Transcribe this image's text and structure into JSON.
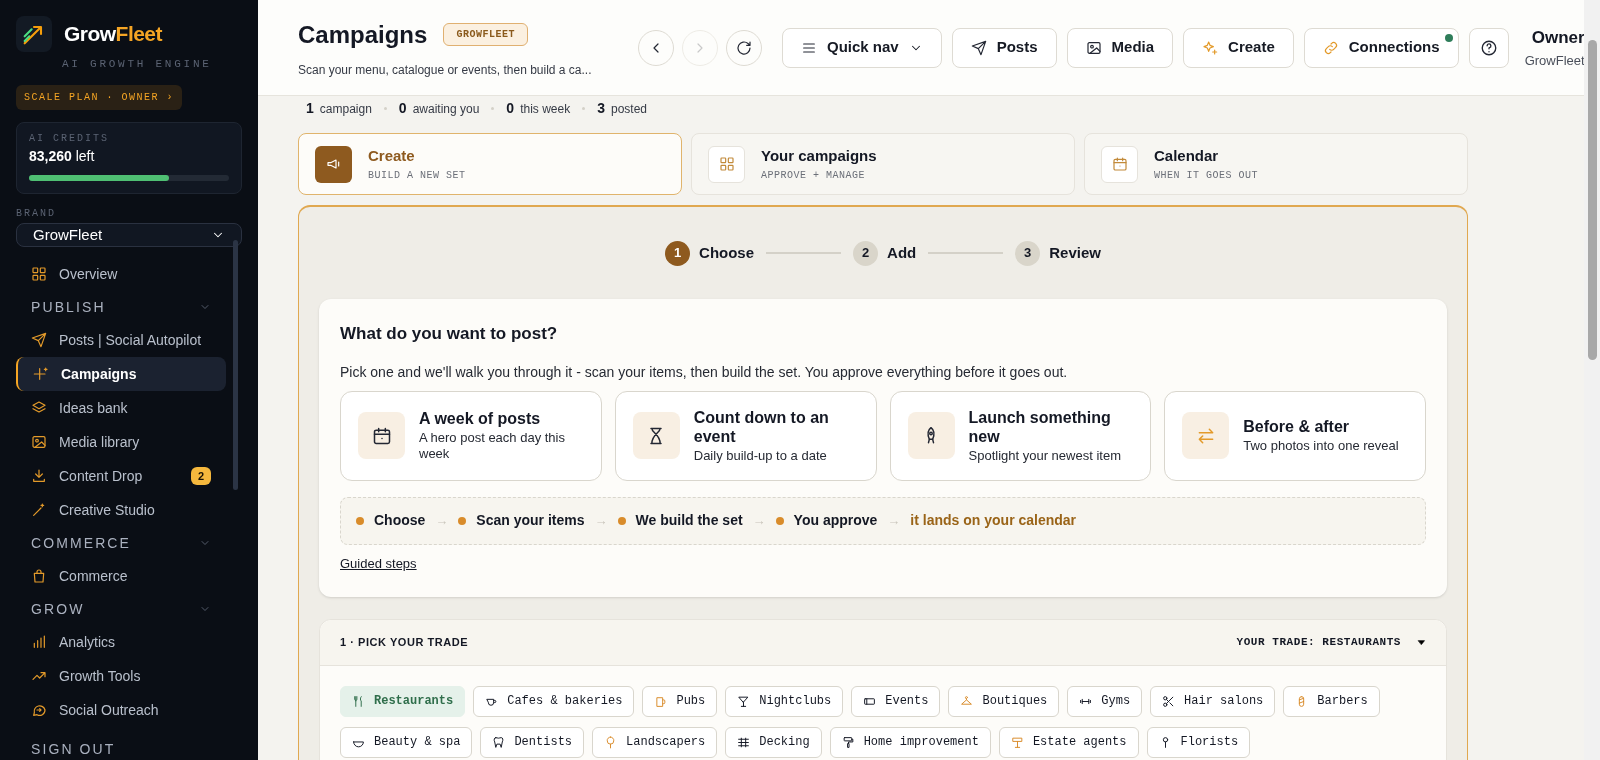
{
  "sidebar": {
    "brand_name": [
      "Grow",
      "Fleet"
    ],
    "tagline": "AI GROWTH ENGINE",
    "plan_badge": "SCALE PLAN · OWNER ›",
    "credits": {
      "label": "AI CREDITS",
      "amount": "83,260",
      "unit": "left",
      "level": 0.7
    },
    "brand_select": {
      "label": "BRAND",
      "value": "GrowFleet"
    },
    "nav": [
      {
        "kind": "item",
        "label": "Overview",
        "selected": false
      },
      {
        "kind": "section",
        "label": "PUBLISH",
        "expanded": true
      },
      {
        "kind": "item",
        "label": "Posts | Social Autopilot",
        "selected": false
      },
      {
        "kind": "item",
        "label": "Campaigns",
        "selected": true
      },
      {
        "kind": "item",
        "label": "Ideas bank",
        "selected": false
      },
      {
        "kind": "item",
        "label": "Media library",
        "selected": false
      },
      {
        "kind": "item",
        "label": "Content Drop",
        "selected": false,
        "badge": "2"
      },
      {
        "kind": "item",
        "label": "Creative Studio",
        "selected": false
      },
      {
        "kind": "section",
        "label": "COMMERCE",
        "expanded": true
      },
      {
        "kind": "item",
        "label": "Commerce",
        "selected": false
      },
      {
        "kind": "section",
        "label": "GROW",
        "expanded": true
      },
      {
        "kind": "item",
        "label": "Analytics",
        "selected": false
      },
      {
        "kind": "item",
        "label": "Growth Tools",
        "selected": false
      },
      {
        "kind": "item",
        "label": "Social Outreach",
        "selected": false
      }
    ],
    "sign_out": "SIGN OUT"
  },
  "header": {
    "title": "Campaigns",
    "badge": "GROWFLEET",
    "subtitle": "Scan your menu, catalogue or events, then build a ca...",
    "history": [
      {
        "kind": "back",
        "disabled": false
      },
      {
        "kind": "forward",
        "disabled": true
      },
      {
        "kind": "refresh",
        "disabled": false
      }
    ],
    "buttons": [
      {
        "label": "Quick nav",
        "notification": false
      },
      {
        "label": "Posts",
        "notification": false
      },
      {
        "label": "Media",
        "notification": false
      },
      {
        "label": "Create",
        "notification": false
      },
      {
        "label": "Connections",
        "notification": true
      }
    ],
    "user": {
      "name": "Owner",
      "org": "GrowFleet"
    }
  },
  "stats": [
    {
      "value": "1",
      "label": "campaign"
    },
    {
      "value": "0",
      "label": "awaiting you"
    },
    {
      "value": "0",
      "label": "this week"
    },
    {
      "value": "3",
      "label": "posted"
    }
  ],
  "tabs": [
    {
      "title": "Create",
      "subtitle": "BUILD A NEW SET",
      "selected": true
    },
    {
      "title": "Your campaigns",
      "subtitle": "APPROVE + MANAGE",
      "selected": false
    },
    {
      "title": "Calendar",
      "subtitle": "WHEN IT GOES OUT",
      "selected": false
    }
  ],
  "stepper": [
    {
      "number": "1",
      "label": "Choose",
      "selected": true
    },
    {
      "number": "2",
      "label": "Add",
      "selected": false
    },
    {
      "number": "3",
      "label": "Review",
      "selected": false
    }
  ],
  "choose_card": {
    "heading": "What do you want to post?",
    "intro": "Pick one and we'll walk you through it - scan your items, then build the set. You approve everything before it goes out.",
    "options": [
      {
        "title": "A week of posts",
        "description": "A hero post each day this week"
      },
      {
        "title": "Count down to an event",
        "description": "Daily build-up to a date"
      },
      {
        "title": "Launch something new",
        "description": "Spotlight your newest item"
      },
      {
        "title": "Before & after",
        "description": "Two photos into one reveal"
      }
    ],
    "flow": [
      {
        "kind": "step",
        "label": "Choose"
      },
      {
        "kind": "step",
        "label": "Scan your items"
      },
      {
        "kind": "step",
        "label": "We build the set"
      },
      {
        "kind": "step",
        "label": "You approve"
      },
      {
        "kind": "final",
        "label": "it lands on your calendar"
      }
    ],
    "separator": "→",
    "link": "Guided steps"
  },
  "trade": {
    "heading": "1 · PICK YOUR TRADE",
    "selection": "YOUR TRADE: RESTAURANTS",
    "chips": [
      {
        "label": "Restaurants",
        "selected": true
      },
      {
        "label": "Cafes & bakeries",
        "selected": false
      },
      {
        "label": "Pubs",
        "selected": false
      },
      {
        "label": "Nightclubs",
        "selected": false
      },
      {
        "label": "Events",
        "selected": false
      },
      {
        "label": "Boutiques",
        "selected": false
      },
      {
        "label": "Gyms",
        "selected": false
      },
      {
        "label": "Hair salons",
        "selected": false
      },
      {
        "label": "Barbers",
        "selected": false
      },
      {
        "label": "Beauty & spa",
        "selected": false
      },
      {
        "label": "Dentists",
        "selected": false
      },
      {
        "label": "Landscapers",
        "selected": false
      },
      {
        "label": "Decking",
        "selected": false
      },
      {
        "label": "Home improvement",
        "selected": false
      },
      {
        "label": "Estate agents",
        "selected": false
      },
      {
        "label": "Florists",
        "selected": false
      }
    ]
  }
}
